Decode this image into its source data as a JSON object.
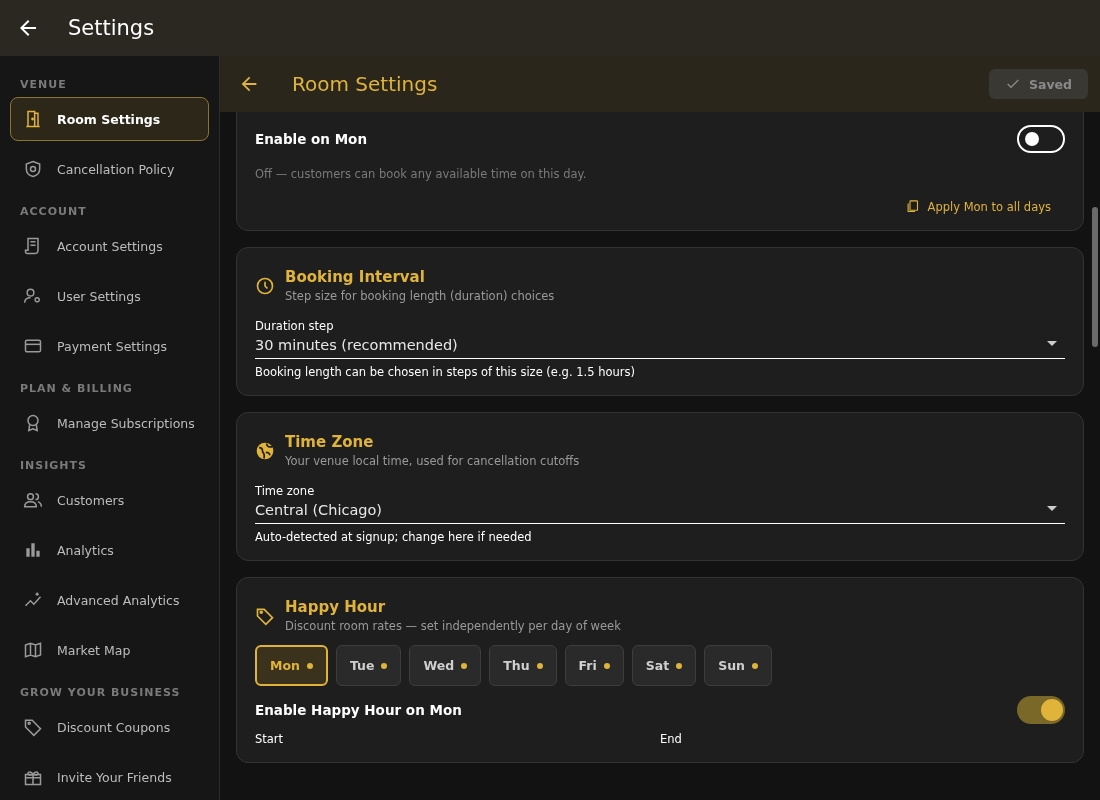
{
  "app_bar": {
    "title": "Settings"
  },
  "sidebar": {
    "sections": [
      {
        "title": "VENUE",
        "items": [
          {
            "label": "Room Settings",
            "selected": true
          },
          {
            "label": "Cancellation Policy",
            "selected": false
          }
        ]
      },
      {
        "title": "ACCOUNT",
        "items": [
          {
            "label": "Account Settings",
            "selected": false
          },
          {
            "label": "User Settings",
            "selected": false
          },
          {
            "label": "Payment Settings",
            "selected": false
          }
        ]
      },
      {
        "title": "PLAN & BILLING",
        "items": [
          {
            "label": "Manage Subscriptions",
            "selected": false
          }
        ]
      },
      {
        "title": "INSIGHTS",
        "items": [
          {
            "label": "Customers",
            "selected": false
          },
          {
            "label": "Analytics",
            "selected": false
          },
          {
            "label": "Advanced Analytics",
            "selected": false
          },
          {
            "label": "Market Map",
            "selected": false
          }
        ]
      },
      {
        "title": "GROW YOUR BUSINESS",
        "items": [
          {
            "label": "Discount Coupons",
            "selected": false
          },
          {
            "label": "Invite Your Friends",
            "selected": false
          }
        ]
      }
    ]
  },
  "page_header": {
    "title": "Room Settings",
    "save_button": "Saved"
  },
  "day_card": {
    "toggle_label": "Enable on Mon",
    "on": false,
    "hint": "Off — customers can book any available time on this day.",
    "apply_link": "Apply Mon to all days"
  },
  "booking_interval": {
    "title": "Booking Interval",
    "subtitle": "Step size for booking length (duration) choices",
    "field_label": "Duration step",
    "value": "30 minutes (recommended)",
    "helper": "Booking length can be chosen in steps of this size (e.g. 1.5 hours)"
  },
  "time_zone": {
    "title": "Time Zone",
    "subtitle": "Your venue local time, used for cancellation cutoffs",
    "field_label": "Time zone",
    "value": "Central (Chicago)",
    "helper": "Auto-detected at signup; change here if needed"
  },
  "happy_hour": {
    "title": "Happy Hour",
    "subtitle": "Discount room rates — set independently per day of week",
    "days": [
      {
        "label": "Mon",
        "selected": true
      },
      {
        "label": "Tue",
        "selected": false
      },
      {
        "label": "Wed",
        "selected": false
      },
      {
        "label": "Thu",
        "selected": false
      },
      {
        "label": "Fri",
        "selected": false
      },
      {
        "label": "Sat",
        "selected": false
      },
      {
        "label": "Sun",
        "selected": false
      }
    ],
    "toggle_label": "Enable Happy Hour on Mon",
    "on": true,
    "start_label": "Start",
    "end_label": "End"
  }
}
